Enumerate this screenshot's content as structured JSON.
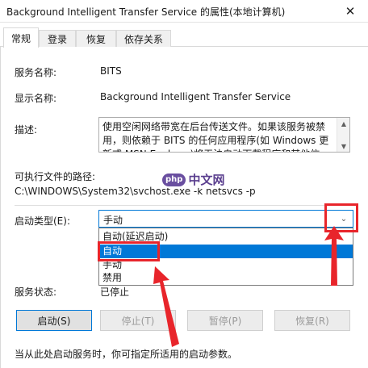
{
  "window": {
    "title": "Background Intelligent Transfer Service 的属性(本地计算机)",
    "close_glyph": "✕"
  },
  "tabs": [
    {
      "label": "常规",
      "active": true
    },
    {
      "label": "登录",
      "active": false
    },
    {
      "label": "恢复",
      "active": false
    },
    {
      "label": "依存关系",
      "active": false
    }
  ],
  "general": {
    "service_name_label": "服务名称:",
    "service_name": "BITS",
    "display_name_label": "显示名称:",
    "display_name": "Background Intelligent Transfer Service",
    "description_label": "描述:",
    "description": "使用空闲网络带宽在后台传送文件。如果该服务被禁用，则依赖于 BITS 的任何应用程序(如 Windows 更新或 MSN Explorer)将无法自动下载程序和其他信息。",
    "exe_path_label": "可执行文件的路径:",
    "exe_path": "C:\\WINDOWS\\System32\\svchost.exe -k netsvcs -p",
    "startup_type_label": "启动类型(E):",
    "startup_type_value": "手动",
    "startup_options": [
      "自动(延迟启动)",
      "自动",
      "手动",
      "禁用"
    ],
    "startup_highlighted_index": 1,
    "service_status_label": "服务状态:",
    "service_status": "已停止",
    "start_hint": "当从此处启动服务时，你可指定所适用的启动参数。"
  },
  "buttons": {
    "start": "启动(S)",
    "stop": "停止(T)",
    "pause": "暂停(P)",
    "resume": "恢复(R)"
  },
  "watermark": {
    "logo": "php",
    "text": "中文网"
  },
  "icons": {
    "chevron_down": "⌄",
    "scroll_up": "▲",
    "scroll_down": "▼"
  },
  "colors": {
    "accent": "#0078d7",
    "annotation_red": "#e8252b",
    "selected_text": "#ffffff"
  }
}
